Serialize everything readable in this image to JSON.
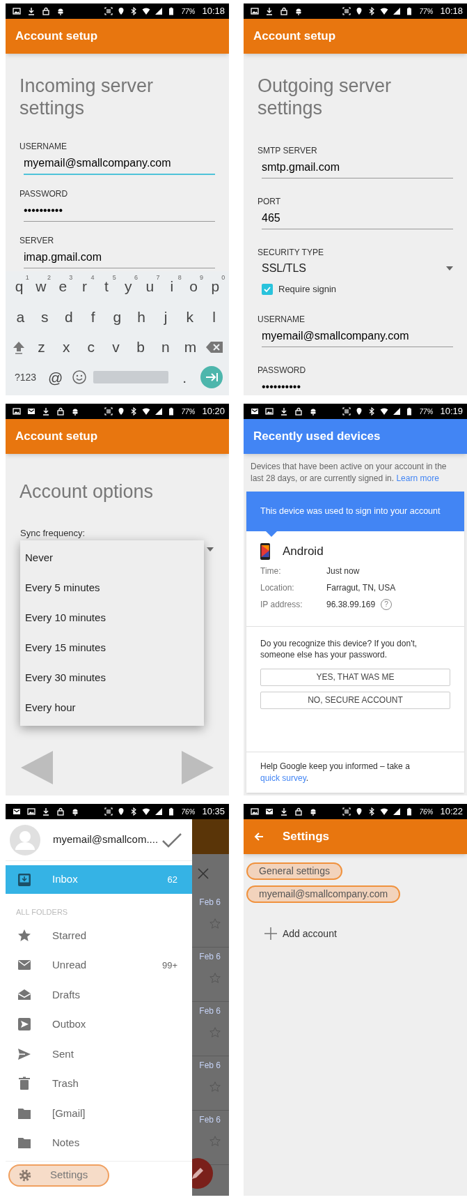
{
  "screens": [
    {
      "kind": "incoming",
      "status_bar": {
        "battery": "77%",
        "time": "10:18"
      },
      "app_bar": {
        "title": "Account setup"
      },
      "heading": "Incoming server settings",
      "fields": [
        {
          "kind": "text",
          "label": "USERNAME",
          "value": "myemail@smallcompany.com",
          "focused": true
        },
        {
          "kind": "text",
          "label": "PASSWORD",
          "value": "••••••••••",
          "focused": false
        },
        {
          "kind": "text",
          "label": "SERVER",
          "value": "imap.gmail.com",
          "focused": false
        }
      ],
      "keyboard": {
        "rows": [
          {
            "keys": [
              {
                "label": "q",
                "hint": "1"
              },
              {
                "label": "w",
                "hint": "2"
              },
              {
                "label": "e",
                "hint": "3"
              },
              {
                "label": "r",
                "hint": "4"
              },
              {
                "label": "t",
                "hint": "5"
              },
              {
                "label": "y",
                "hint": "6"
              },
              {
                "label": "u",
                "hint": "7"
              },
              {
                "label": "i",
                "hint": "8"
              },
              {
                "label": "o",
                "hint": "9"
              },
              {
                "label": "p",
                "hint": "0"
              }
            ]
          },
          {
            "keys": [
              {
                "label": "a"
              },
              {
                "label": "s"
              },
              {
                "label": "d"
              },
              {
                "label": "f"
              },
              {
                "label": "g"
              },
              {
                "label": "h"
              },
              {
                "label": "j"
              },
              {
                "label": "k"
              },
              {
                "label": "l"
              }
            ]
          },
          {
            "keys": [
              {
                "kind": "shift"
              },
              {
                "label": "z"
              },
              {
                "label": "x"
              },
              {
                "label": "c"
              },
              {
                "label": "v"
              },
              {
                "label": "b"
              },
              {
                "label": "n"
              },
              {
                "label": "m"
              },
              {
                "kind": "backspace"
              }
            ]
          },
          {
            "keys": [
              {
                "kind": "wide",
                "label": "?123"
              },
              {
                "label": "@"
              },
              {
                "kind": "emoji"
              },
              {
                "kind": "space"
              },
              {
                "label": "."
              },
              {
                "kind": "enter"
              }
            ]
          }
        ]
      }
    },
    {
      "kind": "outgoing",
      "status_bar": {
        "battery": "77%",
        "time": "10:18"
      },
      "app_bar": {
        "title": "Account setup"
      },
      "heading": "Outgoing server settings",
      "fields": [
        {
          "kind": "text",
          "label": "SMTP SERVER",
          "value": "smtp.gmail.com",
          "focused": false
        },
        {
          "kind": "text",
          "label": "PORT",
          "value": "465",
          "focused": false
        },
        {
          "kind": "select",
          "label": "SECURITY TYPE",
          "value": "SSL/TLS"
        },
        {
          "kind": "checkbox",
          "label": "Require signin",
          "checked": true
        },
        {
          "kind": "text",
          "label": "USERNAME",
          "value": "myemail@smallcompany.com",
          "focused": false
        },
        {
          "kind": "text",
          "label": "PASSWORD",
          "value": "••••••••••",
          "focused": false
        }
      ]
    },
    {
      "kind": "options",
      "status_bar": {
        "battery": "77%",
        "time": "10:20"
      },
      "app_bar": {
        "title": "Account setup"
      },
      "heading": "Account options",
      "select_label": "Sync frequency:",
      "options": [
        "Never",
        "Every 5 minutes",
        "Every 10 minutes",
        "Every 15 minutes",
        "Every 30 minutes",
        "Every hour"
      ]
    },
    {
      "kind": "devices",
      "status_bar": {
        "battery": "77%",
        "time": "10:19"
      },
      "app_bar": {
        "title": "Recently used devices"
      },
      "intro": {
        "text": "Devices that have been active on your account in the last 28 days, or are currently signed in.",
        "link": "Learn more"
      },
      "card": {
        "banner": "This device was used to sign into your account",
        "device": "Android",
        "details": [
          {
            "label": "Time:",
            "value": "Just now"
          },
          {
            "label": "Location:",
            "value": "Farragut, TN, USA"
          },
          {
            "label": "IP address:",
            "value": "96.38.99.169",
            "help": "?"
          }
        ],
        "question": "Do you recognize this device? If you don't, someone else has your password.",
        "buttons": [
          "YES, THAT WAS ME",
          "NO, SECURE ACCOUNT"
        ],
        "footer": {
          "text": "Help Google keep you informed – take a",
          "link": "quick survey",
          "after": "."
        }
      }
    },
    {
      "kind": "drawer",
      "status_bar": {
        "battery": "76%",
        "time": "10:35"
      },
      "account": "myemail@smallcom....",
      "inbox": {
        "label": "Inbox",
        "count": "62",
        "selected": true
      },
      "section": "ALL FOLDERS",
      "folders": [
        {
          "label": "Starred",
          "selected": false
        },
        {
          "label": "Unread",
          "count": "99+",
          "selected": false
        },
        {
          "label": "Drafts",
          "selected": false
        },
        {
          "label": "Outbox",
          "selected": false
        },
        {
          "label": "Sent",
          "selected": false
        },
        {
          "label": "Trash",
          "selected": false
        },
        {
          "label": "[Gmail]",
          "selected": false
        },
        {
          "label": "Notes",
          "selected": false
        }
      ],
      "settings": {
        "label": "Settings",
        "highlighted": true
      },
      "background_dates": [
        "Feb 6",
        "Feb 6",
        "Feb 6",
        "Feb 6",
        "Feb 6"
      ]
    },
    {
      "kind": "settings",
      "status_bar": {
        "battery": "76%",
        "time": "10:22"
      },
      "app_bar": {
        "title": "Settings"
      },
      "items": [
        {
          "label": "General settings",
          "highlighted": true
        },
        {
          "label": "myemail@smallcompany.com",
          "highlighted": true
        }
      ],
      "add_account": {
        "label": "Add account",
        "highlighted": false
      }
    }
  ]
}
